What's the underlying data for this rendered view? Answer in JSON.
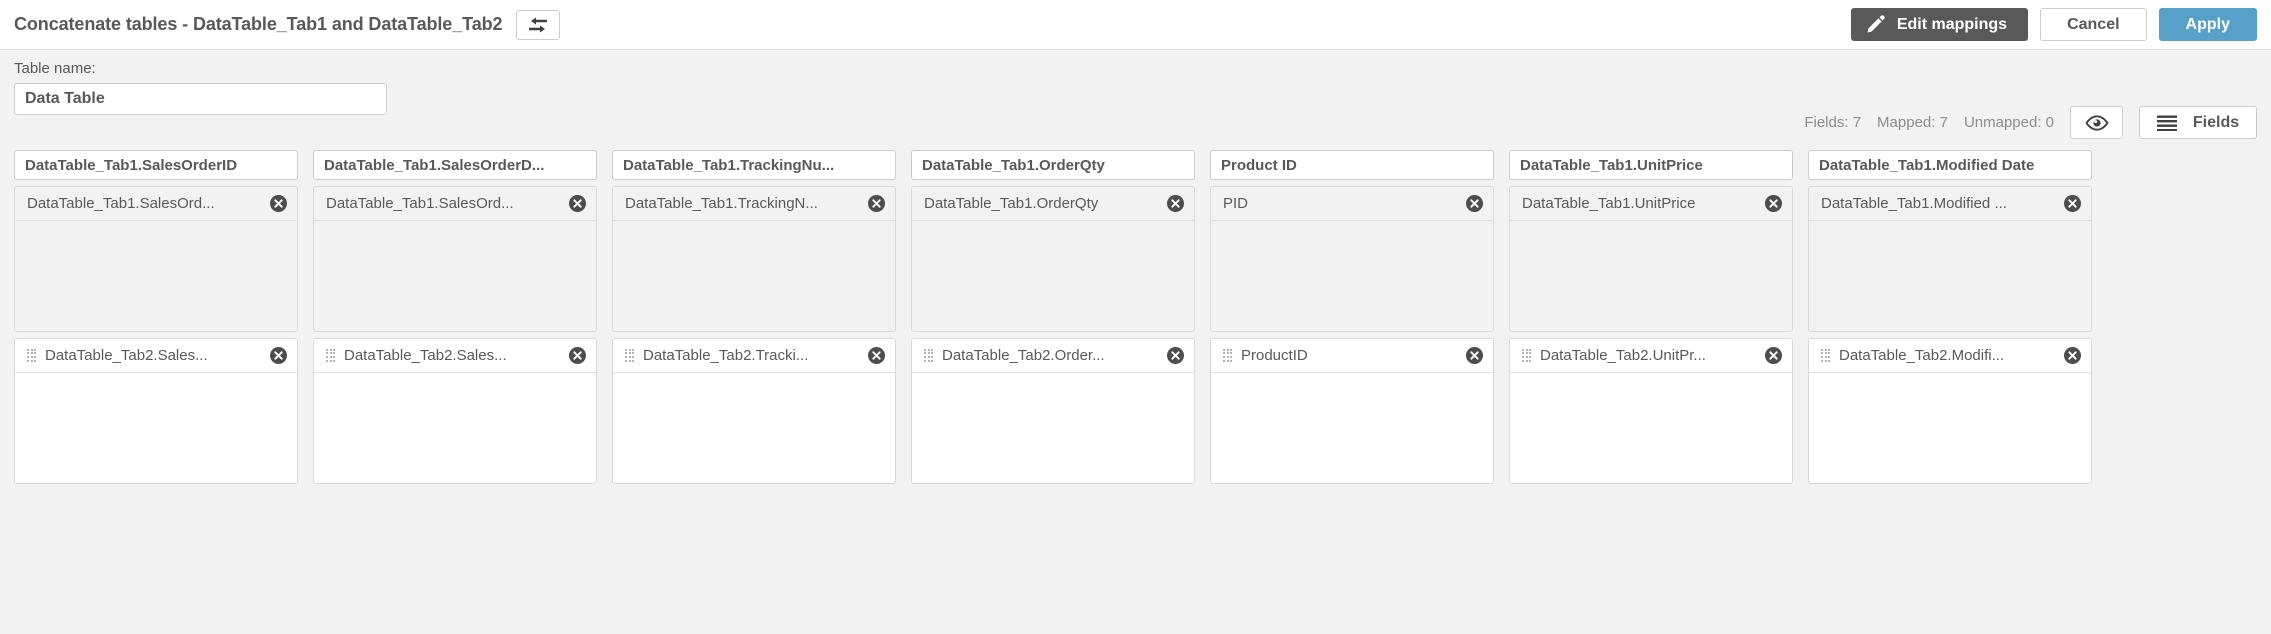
{
  "header": {
    "title": "Concatenate tables - DataTable_Tab1 and DataTable_Tab2",
    "swap_icon": "swap-arrows-icon",
    "edit_mappings_label": "Edit mappings",
    "edit_mappings_icon": "pencil-icon",
    "cancel_label": "Cancel",
    "apply_label": "Apply",
    "accent_color": "#57a0c8",
    "edit_bg_color": "#595959"
  },
  "subbar": {
    "table_name_label": "Table name:",
    "table_name_value": "Data Table",
    "table_name_placeholder": "Table name",
    "stats": [
      "Fields: 7",
      "Mapped: 7",
      "Unmapped: 0"
    ],
    "preview_icon": "eye-icon",
    "fields_icon": "list-lines-icon",
    "fields_label": "Fields"
  },
  "columns": [
    {
      "header": "DataTable_Tab1.SalesOrderID",
      "top_chip": "DataTable_Tab1.SalesOrd...",
      "bottom_chip": "DataTable_Tab2.Sales..."
    },
    {
      "header": "DataTable_Tab1.SalesOrderD...",
      "top_chip": "DataTable_Tab1.SalesOrd...",
      "bottom_chip": "DataTable_Tab2.Sales..."
    },
    {
      "header": "DataTable_Tab1.TrackingNu...",
      "top_chip": "DataTable_Tab1.TrackingN...",
      "bottom_chip": "DataTable_Tab2.Tracki..."
    },
    {
      "header": "DataTable_Tab1.OrderQty",
      "top_chip": "DataTable_Tab1.OrderQty",
      "bottom_chip": "DataTable_Tab2.Order..."
    },
    {
      "header": "Product ID",
      "top_chip": "PID",
      "bottom_chip": "ProductID"
    },
    {
      "header": "DataTable_Tab1.UnitPrice",
      "top_chip": "DataTable_Tab1.UnitPrice",
      "bottom_chip": "DataTable_Tab2.UnitPr..."
    },
    {
      "header": "DataTable_Tab1.Modified Date",
      "top_chip": "DataTable_Tab1.Modified ...",
      "bottom_chip": "DataTable_Tab2.Modifi..."
    }
  ],
  "icons": {
    "remove": "remove-circle-icon",
    "drag": "drag-handle-icon"
  }
}
